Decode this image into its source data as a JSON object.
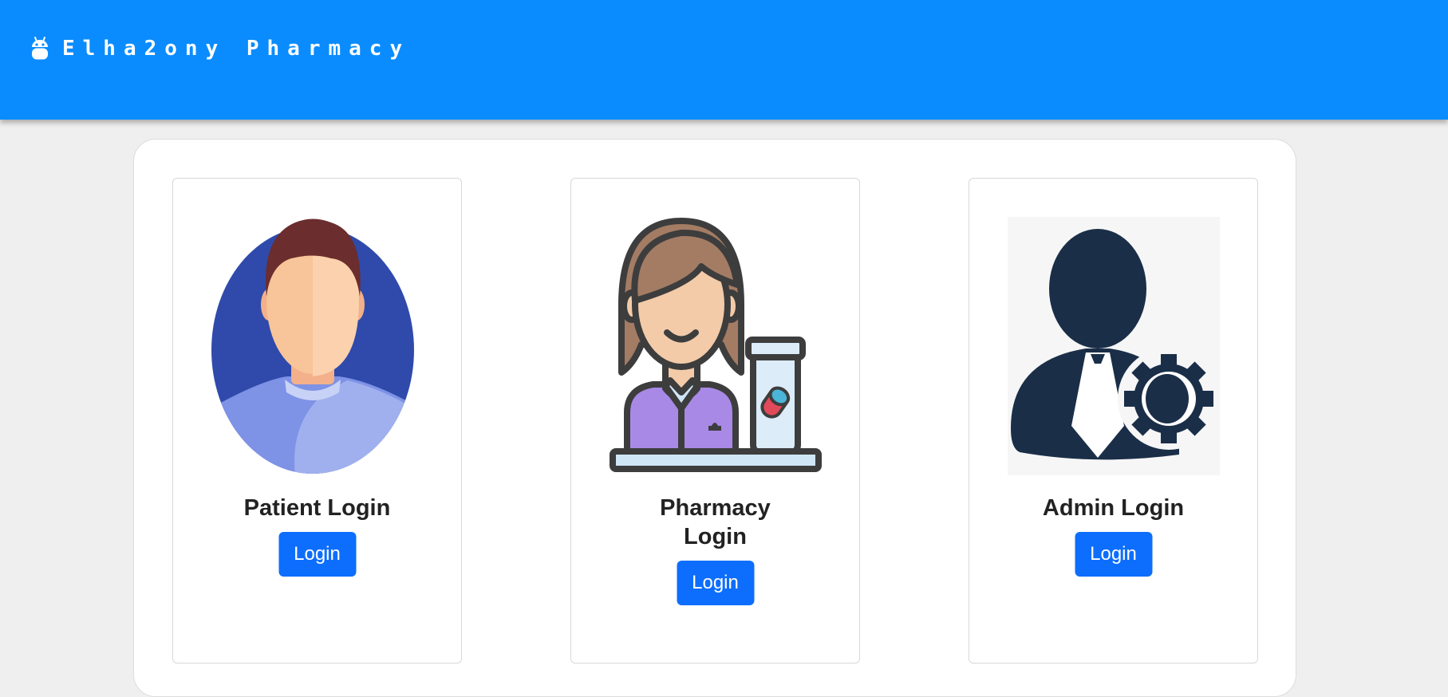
{
  "header": {
    "brand_icon": "android-icon",
    "brand_name": "Elha2ony Pharmacy",
    "background_color": "#0a8cff"
  },
  "cards": [
    {
      "icon": "patient-avatar-icon",
      "title": "Patient Login",
      "button_label": "Login"
    },
    {
      "icon": "pharmacist-avatar-icon",
      "title": "Pharmacy Login",
      "button_label": "Login"
    },
    {
      "icon": "admin-gear-avatar-icon",
      "title": "Admin Login",
      "button_label": "Login"
    }
  ],
  "colors": {
    "button": "#0d6efd",
    "page_background": "#efefef"
  }
}
